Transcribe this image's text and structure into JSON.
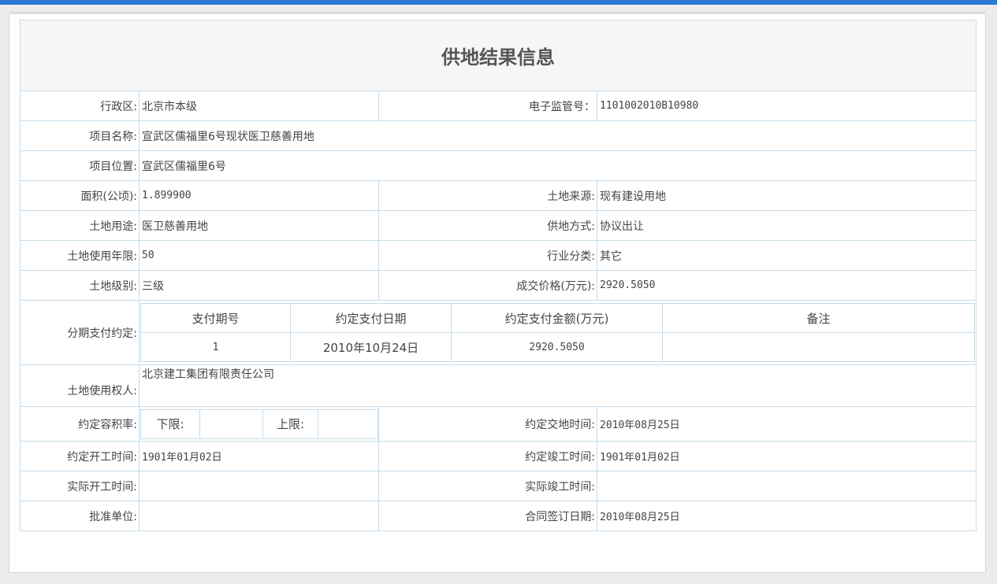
{
  "page": {
    "title": "供地结果信息"
  },
  "fields": {
    "district": {
      "label": "行政区:",
      "value": "北京市本级"
    },
    "supervision_no": {
      "label": "电子监管号：",
      "value": "1101002010B10980"
    },
    "project_name": {
      "label": "项目名称:",
      "value": "宣武区儒福里6号现状医卫慈善用地"
    },
    "project_location": {
      "label": "项目位置:",
      "value": "宣武区儒福里6号"
    },
    "area": {
      "label": "面积(公顷):",
      "value": "1.899900"
    },
    "land_source": {
      "label": "土地来源:",
      "value": "现有建设用地"
    },
    "land_use": {
      "label": "土地用途:",
      "value": "医卫慈善用地"
    },
    "supply_method": {
      "label": "供地方式:",
      "value": "协议出让"
    },
    "use_term": {
      "label": "土地使用年限:",
      "value": "50"
    },
    "industry": {
      "label": "行业分类:",
      "value": "其它"
    },
    "land_grade": {
      "label": "土地级别:",
      "value": "三级"
    },
    "price": {
      "label": "成交价格(万元):",
      "value": "2920.5050"
    },
    "installment": {
      "label": "分期支付约定:"
    },
    "land_user": {
      "label": "土地使用权人:",
      "value": "北京建工集团有限责任公司"
    },
    "far": {
      "label": "约定容积率:",
      "lower_label": "下限:",
      "lower_value": "",
      "upper_label": "上限:",
      "upper_value": ""
    },
    "delivery_time": {
      "label": "约定交地时间:",
      "value": "2010年08月25日"
    },
    "start_time": {
      "label": "约定开工时间:",
      "value": "1901年01月02日"
    },
    "completion_time": {
      "label": "约定竣工时间:",
      "value": "1901年01月02日"
    },
    "actual_start": {
      "label": "实际开工时间:",
      "value": ""
    },
    "actual_completion": {
      "label": "实际竣工时间:",
      "value": ""
    },
    "approval_unit": {
      "label": "批准单位:",
      "value": ""
    },
    "contract_date": {
      "label": "合同签订日期:",
      "value": "2010年08月25日"
    }
  },
  "payment_table": {
    "headers": [
      "支付期号",
      "约定支付日期",
      "约定支付金额(万元)",
      "备注"
    ],
    "rows": [
      [
        "1",
        "2010年10月24日",
        "2920.5050",
        ""
      ]
    ]
  }
}
